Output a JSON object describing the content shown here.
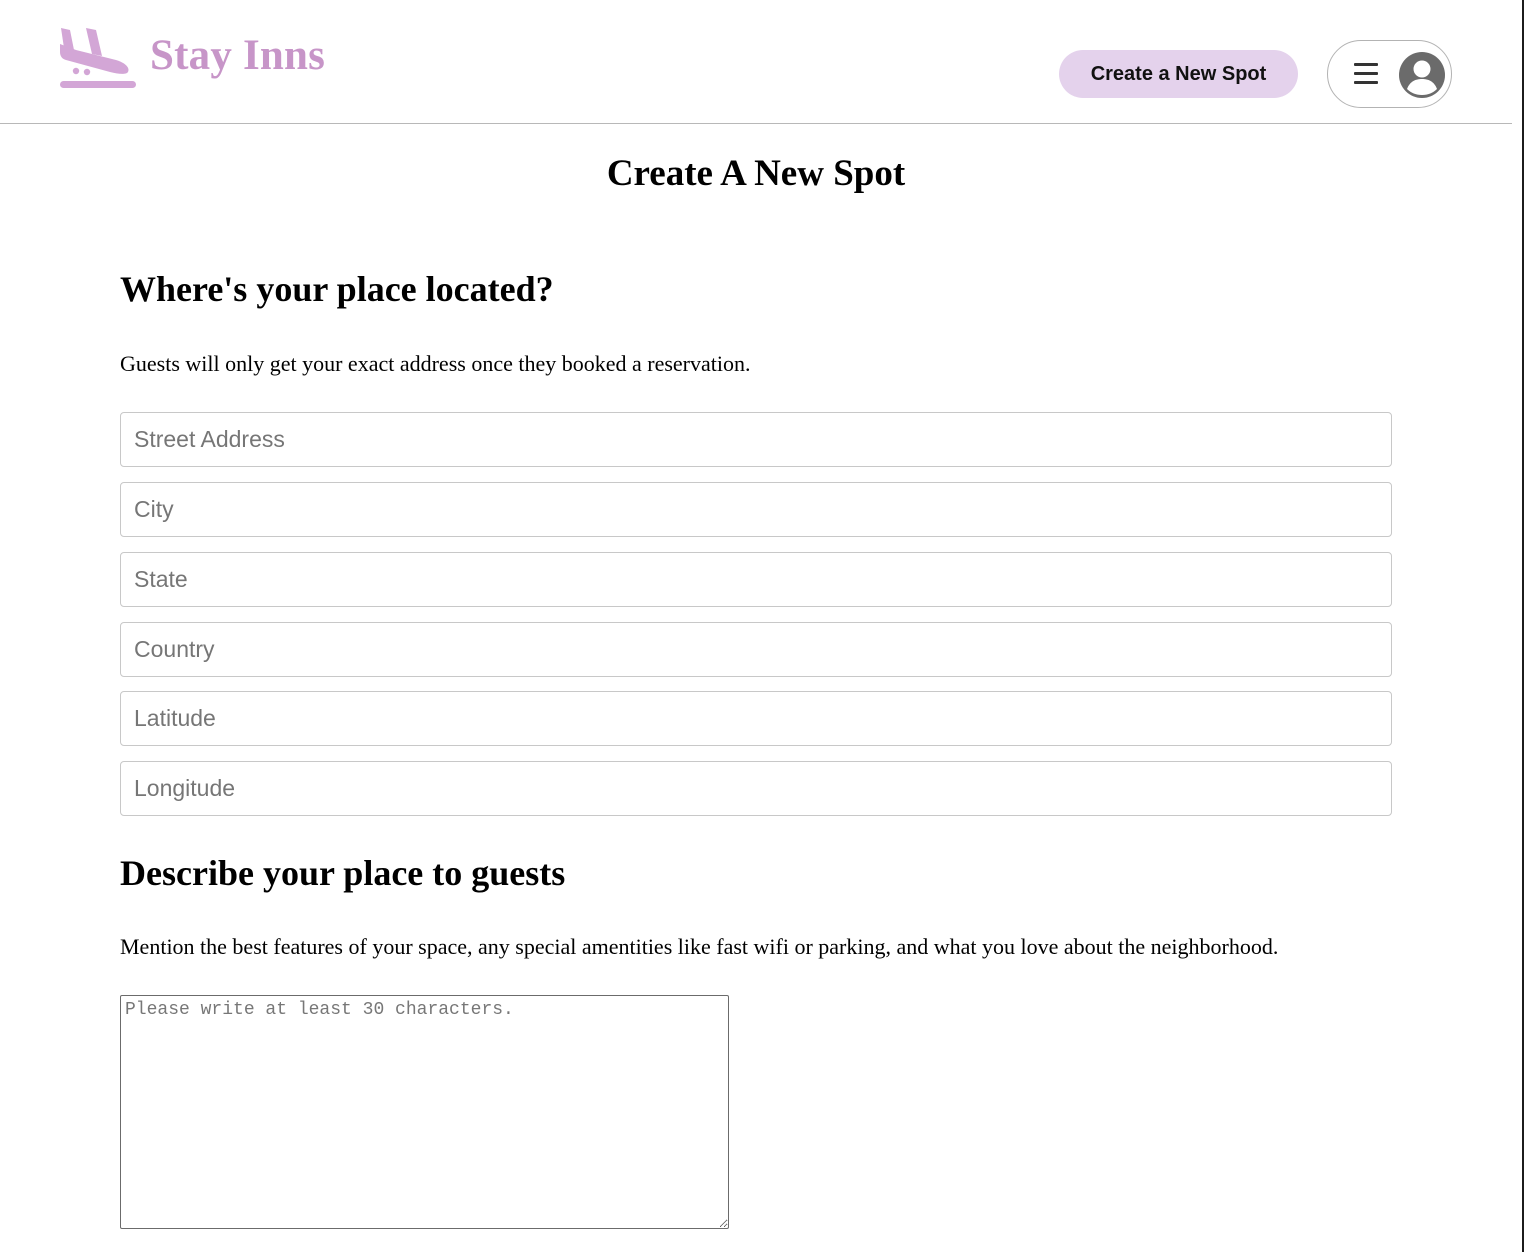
{
  "app": {
    "brand_name": "Stay Inns",
    "brand_color": "#c795c8",
    "logo_icon": "plane-landing-icon"
  },
  "header": {
    "create_button_label": "Create a New Spot",
    "create_button_color": "#e4d2ec",
    "menu_icon": "hamburger-menu-icon",
    "avatar_icon": "user-circle-icon"
  },
  "page": {
    "title": "Create A New Spot"
  },
  "location_section": {
    "heading": "Where's your place located?",
    "description": "Guests will only get your exact address once they booked a reservation.",
    "fields": [
      {
        "name": "street",
        "placeholder": "Street Address",
        "value": ""
      },
      {
        "name": "city",
        "placeholder": "City",
        "value": ""
      },
      {
        "name": "state",
        "placeholder": "State",
        "value": ""
      },
      {
        "name": "country",
        "placeholder": "Country",
        "value": ""
      },
      {
        "name": "latitude",
        "placeholder": "Latitude",
        "value": ""
      },
      {
        "name": "longitude",
        "placeholder": "Longitude",
        "value": ""
      }
    ]
  },
  "description_section": {
    "heading": "Describe your place to guests",
    "description": "Mention the best features of your space, any special amentities like fast wifi or parking, and what you love about the neighborhood.",
    "textarea_placeholder": "Please write at least 30 characters.",
    "textarea_value": ""
  }
}
